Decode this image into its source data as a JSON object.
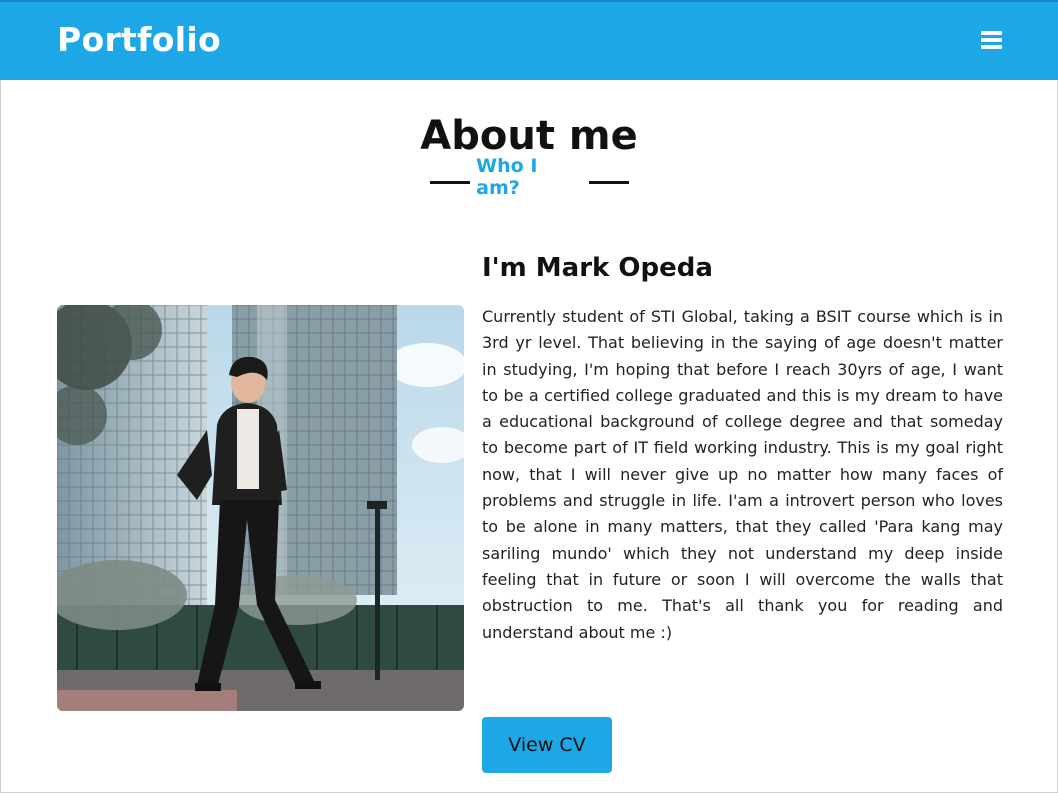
{
  "navbar": {
    "brand": "Portfolio",
    "menu_icon": "hamburger-menu-icon",
    "background_color": "#1ea7e6"
  },
  "section": {
    "title": "About me",
    "subtitle": "Who I am?",
    "accent_color": "#1ea7e6"
  },
  "profile": {
    "photo_description": "man in dark suit standing in front of glass office buildings",
    "name": "I'm Mark Opeda",
    "bio": "Currently student of STI Global, taking a BSIT course which is in 3rd yr level. That believing in the saying of age doesn't matter in studying, I'm hoping that before I reach 30yrs of age, I want to be a certified college graduated and this is my dream to have a educational background of college degree and that someday to become part of IT field working industry. This is my goal right now, that I will never give up no matter how many faces of problems and struggle in life. I'am a introvert person who loves to be alone in many matters, that they called 'Para kang may sariling mundo' which they not understand my deep inside feeling that in future or soon I will overcome the walls that obstruction to me. That's all thank you for reading and understand about me :)",
    "cv_button": "View CV"
  }
}
